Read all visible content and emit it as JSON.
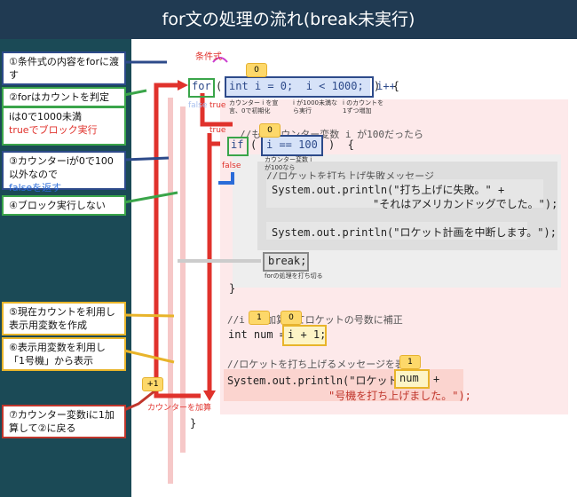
{
  "title": "for文の処理の流れ(break未実行)",
  "notes": [
    "①条件式の内容をforに渡す",
    "②forはカウントを判定",
    "iは0で1000未満",
    "trueでブロック実行",
    "③カウンターiが0で100以外なので",
    "falseを返す",
    "④ブロック実行しない",
    "⑤現在カウントを利用し表示用変数を作成",
    "⑥表示用変数を利用し「1号機」から表示",
    "⑦カウンター変数iに1加算して②に戻る"
  ],
  "labels": {
    "cond": "条件式",
    "true": "true",
    "false": "false",
    "counter_add": "カウンターを加算",
    "plus1": "+1"
  },
  "tags": {
    "t0": "0",
    "t1": "0",
    "t2": "1",
    "t3": "0",
    "t4": "1"
  },
  "code": {
    "for_kw": "for",
    "for_paren": "(",
    "for_cond": "int i = 0;  i < 1000;  i++",
    "for_close": ")  {",
    "comment1": "//もしカウンター変数 i が100だったら",
    "if_kw": "if",
    "if_cond": "i == 100",
    "comment2": "//ロケットを打ち上げ失敗メッセージ",
    "print1a": "System.out.println(\"打ち上げに失敗。\" +",
    "print1b": "\"それはアメリカンドッグでした。\");",
    "print2": "System.out.println(\"ロケット計画を中断します。\");",
    "brk": "break;",
    "close_if": "}",
    "comment3": "//i を1加算してロケットの号数に補正",
    "num_decl": "int num =",
    "num_expr": "i + 1;",
    "comment4": "//ロケットを打ち上げるメッセージを表示",
    "print3a": "System.out.println(\"ロケット\" +",
    "print3_num": "num",
    "print3b": "\"号機を打ち上げました。\");",
    "close_for": "}"
  },
  "small_notes": {
    "s1": "カウンター i を宣言、0で初期化",
    "s2": "i が1000未満なら実行",
    "s3": "i のカウントを1ずつ増加",
    "s4": "カウンター変数 i が100なら",
    "s5": "forの処理を打ち切る"
  }
}
